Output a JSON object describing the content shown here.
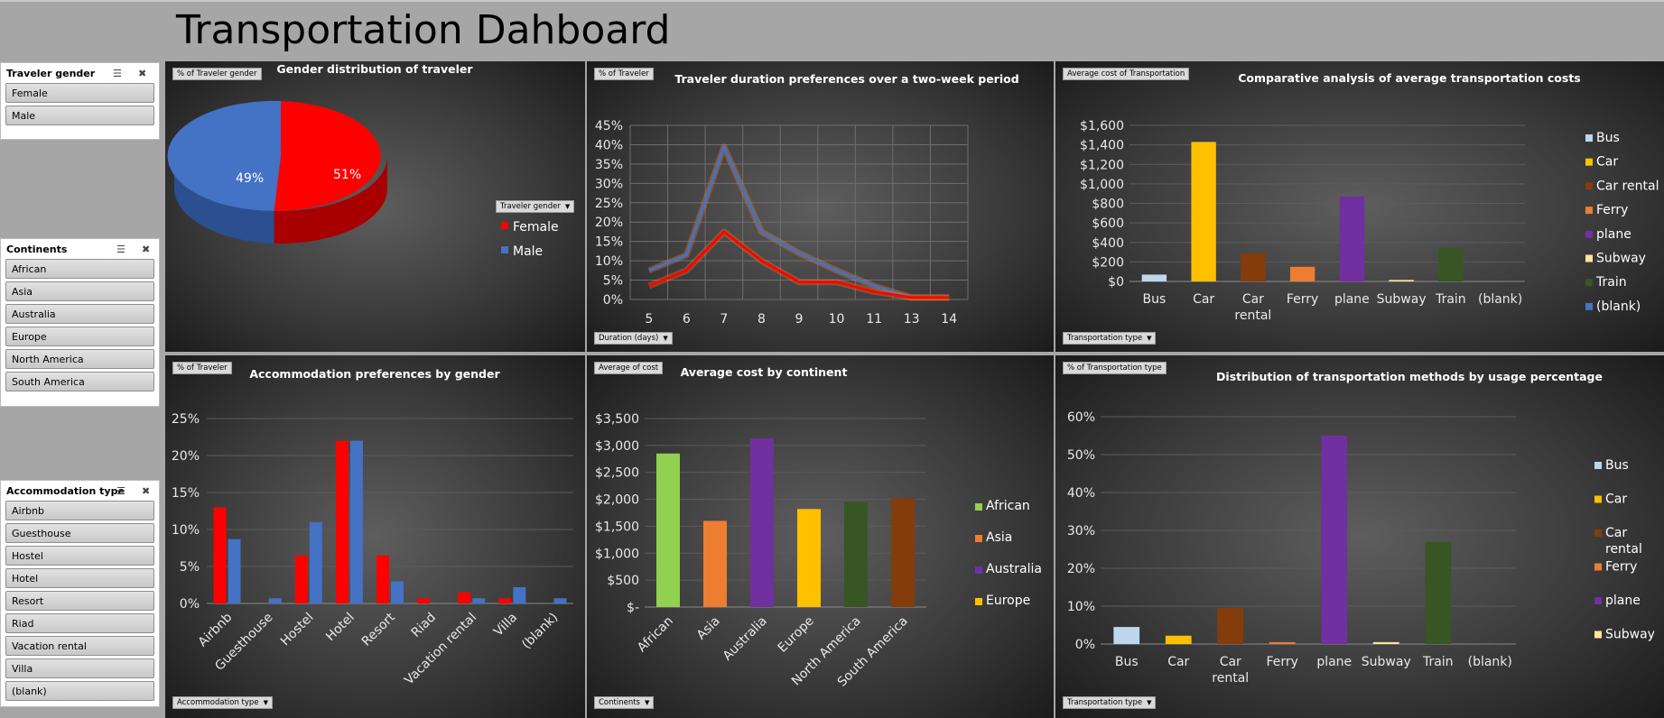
{
  "page_title": "Transportation Dahboard",
  "slicers": {
    "gender": {
      "title": "Traveler gender",
      "items": [
        "Female",
        "Male"
      ]
    },
    "continents": {
      "title": "Continents",
      "items": [
        "African",
        "Asia",
        "Australia",
        "Europe",
        "North America",
        "South America"
      ]
    },
    "accommodation": {
      "title": "Accommodation type",
      "items": [
        "Airbnb",
        "Guesthouse",
        "Hostel",
        "Hotel",
        "Resort",
        "Riad",
        "Vacation rental",
        "Villa",
        "(blank)"
      ]
    }
  },
  "panels": {
    "gender": {
      "field_button": "% of Traveler gender",
      "legend_button": "Traveler gender"
    },
    "duration": {
      "field_button": "% of Traveler",
      "axis_button": "Duration (days)"
    },
    "cost": {
      "field_button": "Average cost of Transportation",
      "axis_button": "Transportation type"
    },
    "accommodation": {
      "field_button": "% of Traveler",
      "axis_button": "Accommodation type"
    },
    "continent": {
      "field_button": "Average  of cost",
      "axis_button": "Continents"
    },
    "usage": {
      "field_button": "% of Transportation type",
      "axis_button": "Transportation type"
    }
  },
  "colors": {
    "female": "#ff0000",
    "male": "#4472c4",
    "bus": "#bdd7ee",
    "car": "#ffc000",
    "car_rental": "#843c0c",
    "ferry": "#ed7d31",
    "plane": "#7030a0",
    "subway": "#ffe699",
    "train": "#375623",
    "blank": "#4472c4",
    "african": "#92d050"
  },
  "chart_data": [
    {
      "id": "gender",
      "type": "pie",
      "title": "Gender distribution of traveler",
      "labels": [
        "Female",
        "Male"
      ],
      "values": [
        51,
        49
      ],
      "data_labels": [
        "51%",
        "49%"
      ],
      "legend": "right"
    },
    {
      "id": "duration",
      "type": "line",
      "title": "Traveler duration preferences over a two-week period",
      "x": [
        5,
        6,
        7,
        8,
        9,
        10,
        11,
        13,
        14
      ],
      "series": [
        {
          "name": "Female",
          "values": [
            3.5,
            7.5,
            17.5,
            10,
            4.5,
            4.5,
            2,
            0.5,
            0.5
          ]
        },
        {
          "name": "Male",
          "values": [
            7.5,
            11.5,
            39.5,
            17.5,
            12,
            7.5,
            3.5,
            0.5,
            0.5
          ]
        }
      ],
      "y_ticks": [
        "0%",
        "5%",
        "10%",
        "15%",
        "20%",
        "25%",
        "30%",
        "35%",
        "40%",
        "45%"
      ],
      "ylim": [
        0,
        45
      ],
      "grid": true
    },
    {
      "id": "cost",
      "type": "bar",
      "title": "Comparative analysis of average transportation costs",
      "categories": [
        "Bus",
        "Car",
        "Car rental",
        "Ferry",
        "plane",
        "Subway",
        "Train",
        "(blank)"
      ],
      "values": [
        70,
        1430,
        290,
        150,
        870,
        15,
        340,
        0
      ],
      "y_ticks": [
        "$0",
        "$200",
        "$400",
        "$600",
        "$800",
        "$1,000",
        "$1,200",
        "$1,400",
        "$1,600"
      ],
      "ylim": [
        0,
        1600
      ],
      "legend": "right",
      "legend_entries": [
        "Bus",
        "Car",
        "Car rental",
        "Ferry",
        "plane",
        "Subway",
        "Train",
        "(blank)"
      ]
    },
    {
      "id": "accommodation",
      "type": "bar",
      "title": "Accommodation preferences by gender",
      "categories": [
        "Airbnb",
        "Guesthouse",
        "Hostel",
        "Hotel",
        "Resort",
        "Riad",
        "Vacation rental",
        "Villa",
        "(blank)"
      ],
      "series": [
        {
          "name": "Female",
          "values": [
            13,
            0,
            6.5,
            22,
            6.5,
            0.7,
            1.5,
            0.7,
            0
          ]
        },
        {
          "name": "Male",
          "values": [
            8.7,
            0.7,
            11,
            22,
            3,
            0,
            0.7,
            2.2,
            0.7
          ]
        }
      ],
      "y_ticks": [
        "0%",
        "5%",
        "10%",
        "15%",
        "20%",
        "25%"
      ],
      "ylim": [
        0,
        25
      ]
    },
    {
      "id": "continent",
      "type": "bar",
      "title": "Average cost by continent",
      "categories": [
        "African",
        "Asia",
        "Australia",
        "Europe",
        "North America",
        "South America"
      ],
      "values": [
        2850,
        1600,
        3130,
        1820,
        1950,
        2020
      ],
      "y_ticks": [
        "$-",
        "$500",
        "$1,000",
        "$1,500",
        "$2,000",
        "$2,500",
        "$3,000",
        "$3,500"
      ],
      "ylim": [
        0,
        3500
      ],
      "legend": "right",
      "legend_entries": [
        "African",
        "Asia",
        "Australia",
        "Europe"
      ]
    },
    {
      "id": "usage",
      "type": "bar",
      "title": "Distribution of transportation methods by usage percentage",
      "categories": [
        "Bus",
        "Car",
        "Car rental",
        "Ferry",
        "plane",
        "Subway",
        "Train",
        "(blank)"
      ],
      "values": [
        4.5,
        2.2,
        9.5,
        0.5,
        55,
        0.5,
        27,
        0
      ],
      "y_ticks": [
        "0%",
        "10%",
        "20%",
        "30%",
        "40%",
        "50%",
        "60%"
      ],
      "ylim": [
        0,
        60
      ],
      "legend": "right",
      "legend_entries": [
        "Bus",
        "Car",
        "Car rental",
        "Ferry",
        "plane",
        "Subway"
      ]
    }
  ]
}
